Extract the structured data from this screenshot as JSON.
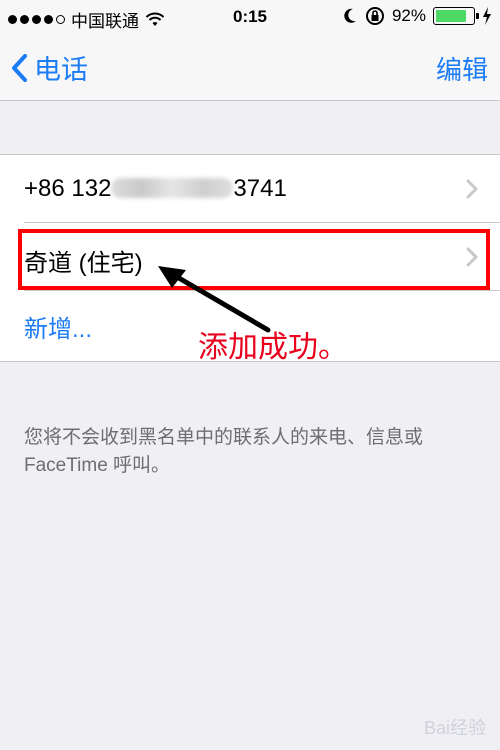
{
  "status_bar": {
    "carrier": "中国联通",
    "time": "0:15",
    "battery_percent_label": "92%",
    "battery_level": 0.92,
    "signal_bars": 4
  },
  "nav": {
    "back_label": "电话",
    "edit_label": "编辑"
  },
  "blocked_list": {
    "items": [
      {
        "label_prefix": "+86 132",
        "label_suffix": "3741"
      },
      {
        "label": "奇道 (住宅)"
      }
    ],
    "add_label": "新增..."
  },
  "annotation": {
    "text": "添加成功。",
    "color": "#e8001c"
  },
  "footer_text": "您将不会收到黑名单中的联系人的来电、信息或 FaceTime 呼叫。",
  "watermark": "Bai经验",
  "colors": {
    "accent": "#1b7cf5",
    "highlight": "#ff0000",
    "battery": "#4cd964"
  }
}
